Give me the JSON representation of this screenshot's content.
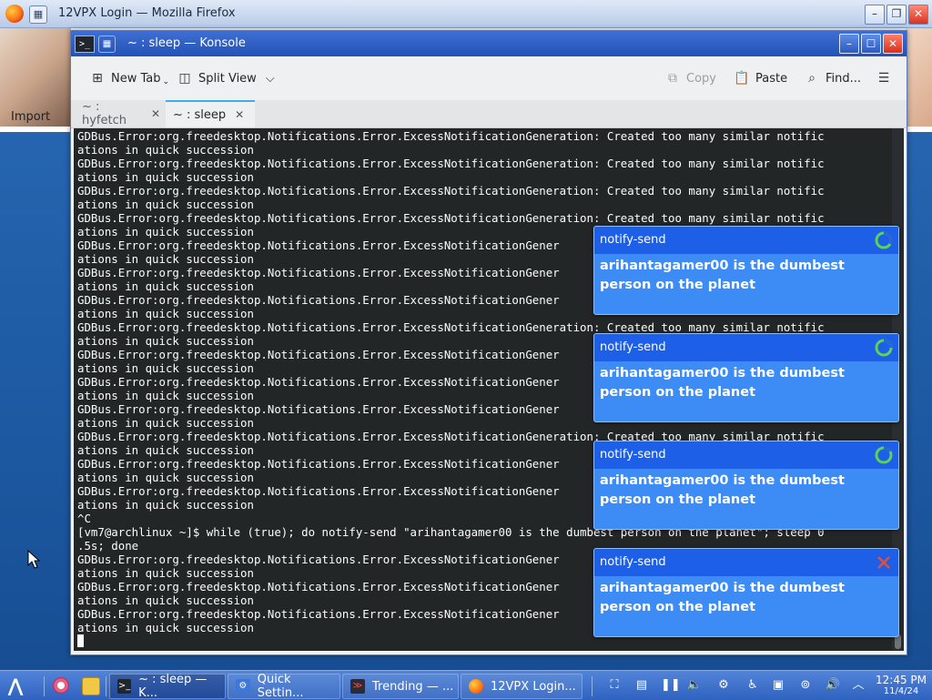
{
  "firefox": {
    "title": "12VPX Login — Mozilla Firefox",
    "import_label": "Import"
  },
  "konsole": {
    "title": "~ : sleep — Konsole",
    "toolbar": {
      "new_tab": "New Tab",
      "split_view": "Split View",
      "copy": "Copy",
      "paste": "Paste",
      "find": "Find..."
    },
    "tabs": [
      {
        "label": "~ : hyfetch",
        "active": false
      },
      {
        "label": "~ : sleep",
        "active": true
      }
    ],
    "terminal_lines": [
      "GDBus.Error:org.freedesktop.Notifications.Error.ExcessNotificationGeneration: Created too many similar notific",
      "ations in quick succession",
      "GDBus.Error:org.freedesktop.Notifications.Error.ExcessNotificationGeneration: Created too many similar notific",
      "ations in quick succession",
      "GDBus.Error:org.freedesktop.Notifications.Error.ExcessNotificationGeneration: Created too many similar notific",
      "ations in quick succession",
      "GDBus.Error:org.freedesktop.Notifications.Error.ExcessNotificationGeneration: Created too many similar notific",
      "ations in quick succession",
      "GDBus.Error:org.freedesktop.Notifications.Error.ExcessNotificationGener",
      "ations in quick succession",
      "GDBus.Error:org.freedesktop.Notifications.Error.ExcessNotificationGener",
      "ations in quick succession",
      "GDBus.Error:org.freedesktop.Notifications.Error.ExcessNotificationGener",
      "ations in quick succession",
      "GDBus.Error:org.freedesktop.Notifications.Error.ExcessNotificationGeneration: Created too many similar notific",
      "ations in quick succession",
      "GDBus.Error:org.freedesktop.Notifications.Error.ExcessNotificationGener",
      "ations in quick succession",
      "GDBus.Error:org.freedesktop.Notifications.Error.ExcessNotificationGener",
      "ations in quick succession",
      "GDBus.Error:org.freedesktop.Notifications.Error.ExcessNotificationGener",
      "ations in quick succession",
      "GDBus.Error:org.freedesktop.Notifications.Error.ExcessNotificationGeneration: Created too many similar notific",
      "ations in quick succession",
      "GDBus.Error:org.freedesktop.Notifications.Error.ExcessNotificationGener",
      "ations in quick succession",
      "GDBus.Error:org.freedesktop.Notifications.Error.ExcessNotificationGener",
      "ations in quick succession",
      "^C",
      "[vm7@archlinux ~]$ while (true); do notify-send \"arihantagamer00 is the dumbest person on the planet\"; sleep 0",
      ".5s; done",
      "GDBus.Error:org.freedesktop.Notifications.Error.ExcessNotificationGener",
      "ations in quick succession",
      "GDBus.Error:org.freedesktop.Notifications.Error.ExcessNotificationGener",
      "ations in quick succession",
      "GDBus.Error:org.freedesktop.Notifications.Error.ExcessNotificationGener",
      "ations in quick succession"
    ]
  },
  "notifications": [
    {
      "app": "notify-send",
      "body": "arihantagamer00 is the dumbest person on the planet"
    },
    {
      "app": "notify-send",
      "body": "arihantagamer00 is the dumbest person on the planet"
    },
    {
      "app": "notify-send",
      "body": "arihantagamer00 is the dumbest person on the planet"
    },
    {
      "app": "notify-send",
      "body": "arihantagamer00 is the dumbest person on the planet"
    }
  ],
  "taskbar": {
    "tasks": [
      {
        "label": "~ : sleep — K...",
        "icon": "terminal-icon"
      },
      {
        "label": "Quick Settin...",
        "icon": "settings-icon"
      },
      {
        "label": "Trending — ...",
        "icon": "trending-icon"
      },
      {
        "label": "12VPX Login...",
        "icon": "firefox-icon"
      }
    ],
    "clock_time": "12:45 PM",
    "clock_date": "11/4/24"
  },
  "colors": {
    "konsole_title": "#2453b7",
    "notification_bg": "#3d8cf5",
    "notification_header": "#1d5fe6",
    "terminal_bg": "#232627",
    "taskbar": "#3a6cc8"
  }
}
